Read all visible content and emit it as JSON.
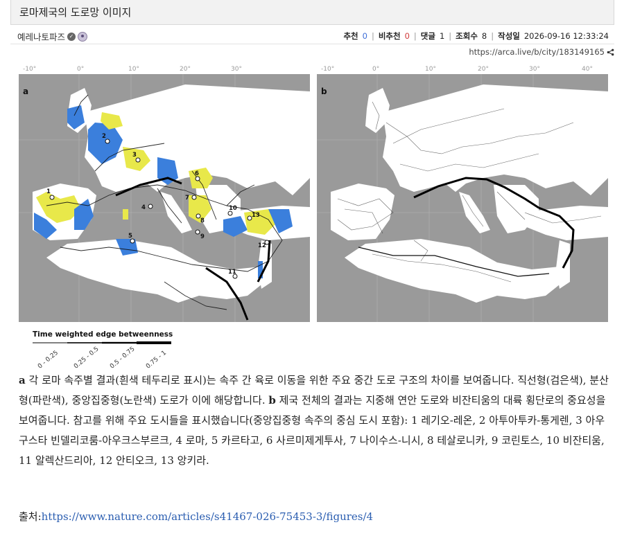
{
  "post": {
    "title": "로마제국의 도로망 이미지",
    "author": "예레나토파즈",
    "url": "https://arca.live/b/city/183149165"
  },
  "stats": {
    "recommend_label": "추천",
    "recommend": "0",
    "unrecommend_label": "비추천",
    "unrecommend": "0",
    "comments_label": "댓글",
    "comments": "1",
    "views_label": "조회수",
    "views": "8",
    "date_label": "작성일",
    "date": "2026-09-16 12:33:24"
  },
  "figure": {
    "panel_a": "a",
    "panel_b": "b",
    "longitudes": [
      "-10°",
      "0°",
      "10°",
      "20°",
      "30°",
      "40°"
    ],
    "city_labels": [
      "1",
      "2",
      "3",
      "4",
      "5",
      "6",
      "7",
      "8",
      "9",
      "10",
      "11",
      "12",
      "13"
    ],
    "legend_title": "Time weighted edge betweenness",
    "legend_ticks": [
      "0 - 0.25",
      "0.25 - 0.5",
      "0.5 - 0.75",
      "0.75 - 1"
    ]
  },
  "caption": {
    "a_letter": "a",
    "a_text": " 각 로마 속주별 결과(흰색 테두리로 표시)는 속주 간 육로 이동을 위한 주요 중간 도로 구조의 차이를 보여줍니다. 직선형(검은색), 분산형(파란색), 중앙집중형(노란색) 도로가 이에 해당합니다. ",
    "b_letter": "b",
    "b_text": " 제국 전체의 결과는 지중해 연안 도로와 비잔티움의 대륙 횡단로의 중요성을 보여줍니다. 참고를 위해 주요 도시들을 표시했습니다(중앙집중형 속주의 중심 도시 포함): 1 레기오-레온, 2 아투아투카-통게렌, 3 아우구스타 빈델리코룸-아우크스부르크, 4 로마, 5 카르타고, 6 사르미제게투사, 7 나이수스-니시, 8 테살로니카, 9 코린토스, 10 비잔티움, 11 알렉산드리아, 12 안티오크, 13 앙키라."
  },
  "source": {
    "label": "출처:",
    "link": "https://www.nature.com/articles/s41467-026-75453-3/figures/4"
  },
  "colors": {
    "link": "#2a5db0",
    "recommend": "#3d6ed8",
    "unrecommend": "#d03a3a",
    "land": "#ffffff",
    "sea": "#9a9a9a",
    "distributed": "#3b7fdc",
    "centralized": "#e8e84a"
  }
}
